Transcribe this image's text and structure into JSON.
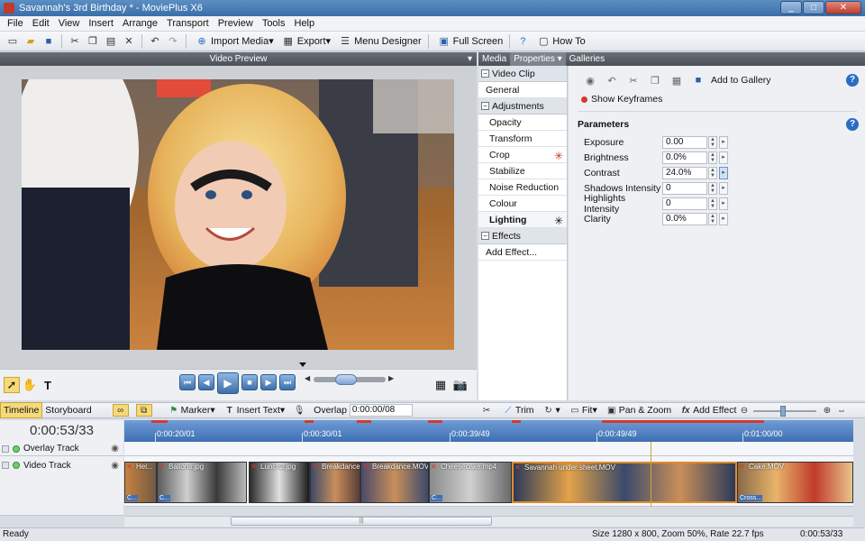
{
  "window": {
    "title": "Savannah's 3rd Birthday * - MoviePlus X6",
    "controls": {
      "minimize": "_",
      "maximize": "□",
      "close": "✕"
    }
  },
  "menu": [
    {
      "label": "File"
    },
    {
      "label": "Edit"
    },
    {
      "label": "View"
    },
    {
      "label": "Insert"
    },
    {
      "label": "Arrange"
    },
    {
      "label": "Transport"
    },
    {
      "label": "Preview"
    },
    {
      "label": "Tools"
    },
    {
      "label": "Help"
    }
  ],
  "toolbar": {
    "import_media": "Import Media",
    "export": "Export",
    "menu_designer": "Menu Designer",
    "full_screen": "Full Screen",
    "how_to": "How To"
  },
  "preview": {
    "header": "Video Preview"
  },
  "tabs": [
    {
      "label": "Media"
    },
    {
      "label": "Properties"
    },
    {
      "label": "Galleries"
    }
  ],
  "properties_list": {
    "video_clip": "Video Clip",
    "general": "General",
    "adjustments": "Adjustments",
    "items": [
      "Opacity",
      "Transform",
      "Crop",
      "Stabilize",
      "Noise Reduction",
      "Colour",
      "Lighting"
    ],
    "effects": "Effects",
    "add_effect": "Add Effect..."
  },
  "properties_panel": {
    "add_to_gallery": "Add to Gallery",
    "show_keyframes": "Show Keyframes",
    "parameters_title": "Parameters",
    "params": [
      {
        "label": "Exposure",
        "value": "0.00"
      },
      {
        "label": "Brightness",
        "value": "0.0%"
      },
      {
        "label": "Contrast",
        "value": "24.0%"
      },
      {
        "label": "Shadows Intensity",
        "value": "0"
      },
      {
        "label": "Highlights Intensity",
        "value": "0"
      },
      {
        "label": "Clarity",
        "value": "0.0%"
      }
    ]
  },
  "timeline_toolbar": {
    "timeline": "Timeline",
    "storyboard": "Storyboard",
    "marker": "Marker",
    "insert_text": "Insert Text",
    "overlap_label": "Overlap",
    "overlap_value": "0:00:00/08",
    "trim": "Trim",
    "fit": "Fit",
    "pan_zoom": "Pan & Zoom",
    "add_effect": "Add Effect"
  },
  "timeline": {
    "timecode": "0:00:53/33",
    "ruler_labels": [
      "0:00:20/01",
      "0:00:30/01",
      "0:00:39/49",
      "0:00:49/49",
      "0:01:00/00"
    ],
    "tracks": {
      "overlay": "Overlay Track",
      "video": "Video Track"
    },
    "clips": [
      {
        "label": "Hel..."
      },
      {
        "label": "Ballons.jpg"
      },
      {
        "label": "Lunch2.jpg"
      },
      {
        "label": "Breakdance"
      },
      {
        "label": "Breakdance.MOV"
      },
      {
        "label": "Cheesecake.mp4"
      },
      {
        "label": "Savannah under sheet.MOV"
      },
      {
        "label": "Cake.MOV"
      }
    ],
    "transitions": [
      "C...",
      "C...",
      "C...",
      "Cross..."
    ]
  },
  "status": {
    "left": "Ready",
    "mid": "Size 1280 x 800, Zoom 50%, Rate 22.7 fps",
    "right": "0:00:53/33"
  }
}
